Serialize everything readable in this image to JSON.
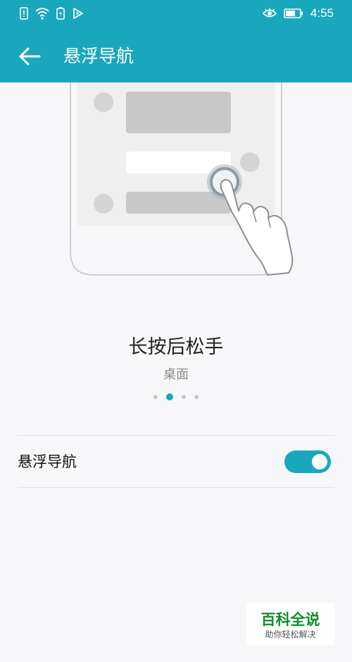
{
  "status_bar": {
    "time": "4:55",
    "left_icons": [
      "alert-sim-icon",
      "wifi-icon",
      "charging-icon",
      "play-icon"
    ],
    "right_icons": [
      "eye-icon",
      "battery-icon"
    ]
  },
  "header": {
    "title": "悬浮导航",
    "back_icon": "arrow-left-icon"
  },
  "illustration": {
    "caption_title": "长按后松手",
    "caption_subtitle": "桌面"
  },
  "pager": {
    "count": 4,
    "active_index": 1
  },
  "settings": {
    "floating_nav_label": "悬浮导航",
    "floating_nav_enabled": true
  },
  "watermark": {
    "title": "百科全说",
    "subtitle": "助你轻松解决"
  },
  "colors": {
    "accent": "#19a7bd",
    "background": "#f7f7f9"
  }
}
